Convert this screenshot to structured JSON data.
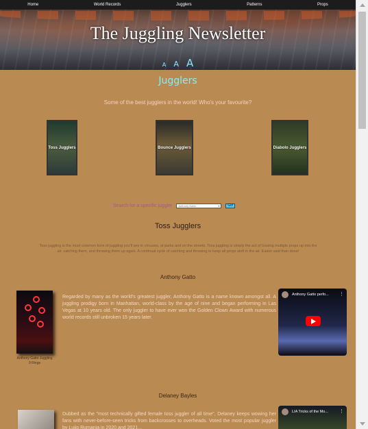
{
  "nav": {
    "items": [
      "Home",
      "World Records",
      "Jugglers",
      "Patterns",
      "Props"
    ]
  },
  "header": {
    "title": "The Juggling Newsletter",
    "font_sizers": [
      "A",
      "A",
      "A"
    ]
  },
  "section": {
    "title": "Jugglers",
    "subtitle": "Some of the best jugglers in the world! Who's your favourite?"
  },
  "categories": [
    {
      "label": "Toss Jugglers"
    },
    {
      "label": "Bounce Jugglers"
    },
    {
      "label": "Diabolo Jugglers"
    }
  ],
  "search": {
    "label": "Search for a specific juggler",
    "selected": "Anthony Gatto",
    "button": "Go!"
  },
  "toss": {
    "heading": "Toss Jugglers",
    "description": "Toss juggling is the most common form of juggling you'll see in circuses, at parks and on the streets. Toss juggling is simply the act of tossing multiple props up into the air, catching them, and throwing them up again. A continual cycle of catching and throwing to keep all props aloft in the air. Easier said than done!"
  },
  "jugglers": [
    {
      "name": "Anthony Gatto",
      "caption": "Anthony Gatto Juggling 9 Rings",
      "bio": "Regarded by many as the world's greatest juggler, Anthony Gatto is a name known amongst all. A juggling prodigy born in Manhattan, world-class by the age of nine and began performing in Las Vegas at 10 years old. The only juggler to have ever won the Golden Clown Award with numerous world records still unbroken 15 years later.",
      "video_title": "Anthony Gatto perfo..."
    },
    {
      "name": "Delaney Bayles",
      "bio": "Dubbed as the \"most technically gifted female toss juggler of all time\", Delaney keeps wowing her fans with never-before-seen tricks from backcrosses to overheads. Voted the most popular juggler by Lujio Rumania in 2020 and 2021...",
      "video_title": "LIA Tricks of the Mo..."
    }
  ],
  "colors": {
    "background": "#b98a52",
    "accent": "#7ff0ff",
    "nav": "#1c1c1c"
  }
}
